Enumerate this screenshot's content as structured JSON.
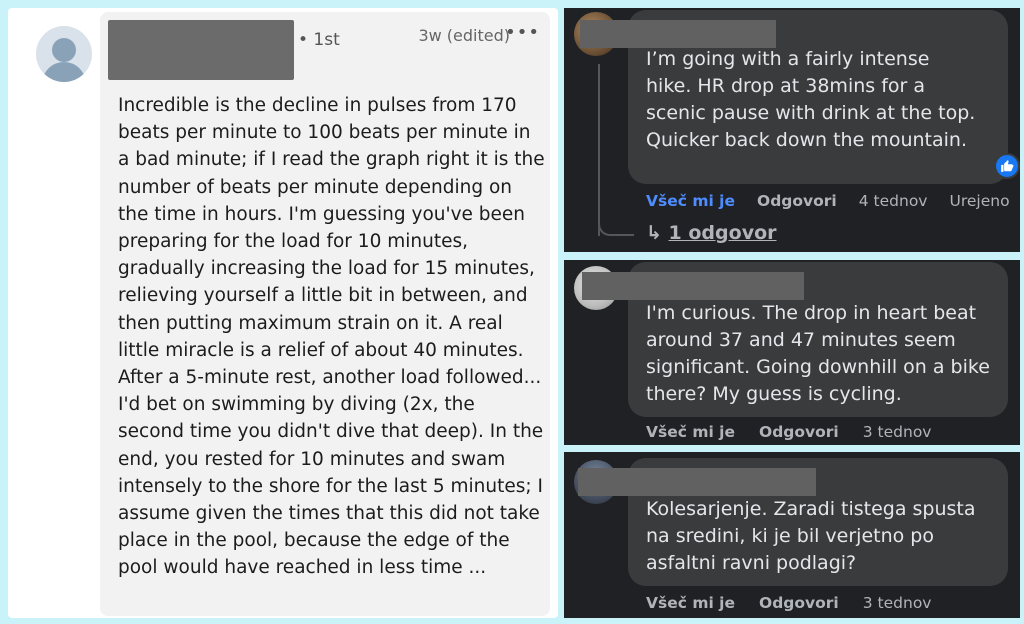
{
  "left_comment": {
    "connection": "• 1st",
    "time": "3w (edited)",
    "more_icon": "•••",
    "text": "Incredible is the decline in pulses from 170 beats per minute to 100 beats per minute in a bad minute; if I read the graph right it is the number of beats per minute depending on the time in hours. I'm guessing you've been preparing for the load for 10 minutes, gradually increasing the load for 15 minutes, relieving yourself a little bit in between, and then putting maximum strain on it. A real little miracle is a relief of about 40 minutes. After a 5-minute rest, another load followed... I'd bet on swimming by diving (2x, the second time you didn't dive that deep). In the end, you rested for 10 minutes and swam intensely to the shore for the last 5 minutes; I assume given the times that this did not take place in the pool, because the edge of the pool would have reached in less time ..."
  },
  "dark_comments": [
    {
      "text": "I’m going with a fairly intense hike. HR drop at 38mins for a scenic pause with drink at the top. Quicker back down the mountain.",
      "like": "Všeč mi je",
      "reply": "Odgovori",
      "time": "4 tednov",
      "edited": "Urejeno",
      "reaction_icon": "thumbs-up-icon",
      "replies_link": "1 odgovor",
      "replies_arrow": "↳"
    },
    {
      "text": "I'm curious. The drop in heart beat around 37 and 47 minutes seem significant. Going downhill on a bike there? My guess is cycling.",
      "like": "Všeč mi je",
      "reply": "Odgovori",
      "time": "3 tednov"
    },
    {
      "text": "Kolesarjenje. Zaradi tistega spusta na sredini, ki je bil verjetno po asfaltni ravni podlagi?",
      "like": "Všeč mi je",
      "reply": "Odgovori",
      "time": "3 tednov"
    }
  ],
  "colors": {
    "background": "#c9f3f8",
    "dark_panel": "#202124",
    "dark_bubble": "#3a3b3c",
    "link_blue": "#4e8dff",
    "like_badge": "#1877f2"
  }
}
